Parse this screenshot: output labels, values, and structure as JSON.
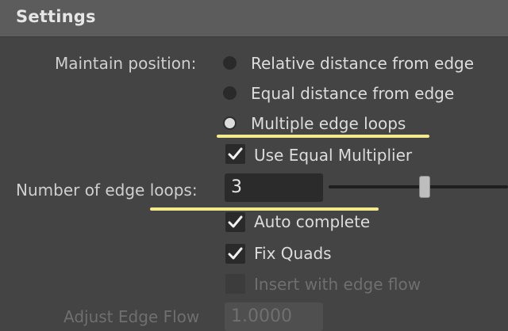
{
  "header": {
    "title": "Settings"
  },
  "maintain_position": {
    "label": "Maintain position:",
    "options": [
      {
        "label": "Relative distance from edge",
        "selected": false
      },
      {
        "label": "Equal distance from edge",
        "selected": false
      },
      {
        "label": "Multiple edge loops",
        "selected": true
      }
    ]
  },
  "use_equal_multiplier": {
    "label": "Use Equal Multiplier",
    "checked": true
  },
  "number_of_edge_loops": {
    "label": "Number of edge loops:",
    "value": "3"
  },
  "auto_complete": {
    "label": "Auto complete",
    "checked": true
  },
  "fix_quads": {
    "label": "Fix Quads",
    "checked": true
  },
  "insert_with_edge_flow": {
    "label": "Insert with edge flow",
    "checked": false,
    "enabled": false
  },
  "adjust_edge_flow": {
    "label": "Adjust Edge Flow",
    "value": "1.0000",
    "enabled": false
  },
  "colors": {
    "panel_bg": "#444444",
    "header_bg": "#5c5c5c",
    "highlight": "#f3ea8c"
  }
}
